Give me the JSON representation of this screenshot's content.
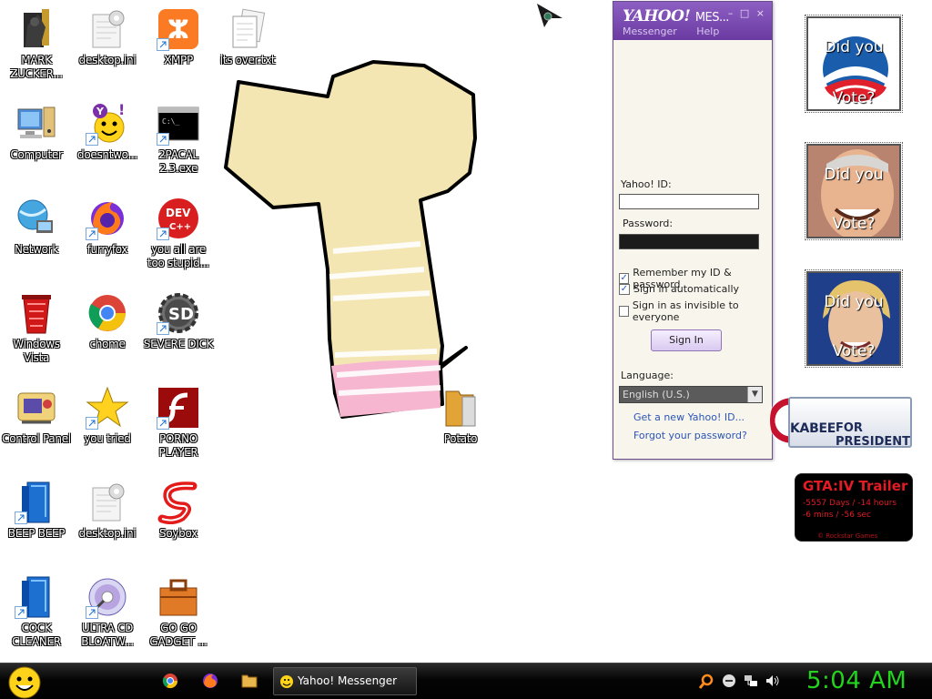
{
  "desktop": {
    "icons": [
      {
        "label": "MARK ZUCKER..."
      },
      {
        "label": "desktop.ini"
      },
      {
        "label": "XMPP"
      },
      {
        "label": "its over.txt"
      },
      {
        "label": "Computer"
      },
      {
        "label": "doesntwo..."
      },
      {
        "label": "2PACAL 2.3.exe"
      },
      {
        "label": "Network"
      },
      {
        "label": "furryfox"
      },
      {
        "label": "you all are too stupid..."
      },
      {
        "label": "Windows Vista"
      },
      {
        "label": "chome"
      },
      {
        "label": "SEVERE DICK"
      },
      {
        "label": "Control Panel"
      },
      {
        "label": "you tried"
      },
      {
        "label": "PORNO PLAYER"
      },
      {
        "label": "BEEP BEEP"
      },
      {
        "label": "desktop.ini"
      },
      {
        "label": "Soybox"
      },
      {
        "label": "COCK CLEANER"
      },
      {
        "label": "ULTRA CD BLOATW..."
      },
      {
        "label": "GO GO GADGET ..."
      },
      {
        "label": "Potato"
      }
    ]
  },
  "messenger": {
    "brand": "YAHOO!",
    "title_suffix": "MES...",
    "window_buttons": "– □ ×",
    "menu": [
      "Messenger",
      "Help"
    ],
    "yahoo_id_label": "Yahoo! ID:",
    "yahoo_id_value": "",
    "password_label": "Password:",
    "remember_label": "Remember my ID & password",
    "remember_checked": true,
    "auto_label": "Sign in automatically",
    "auto_checked": true,
    "invisible_label": "Sign in as invisible to everyone",
    "invisible_checked": false,
    "signin_label": "Sign In",
    "language_label": "Language:",
    "language_value": "English (U.S.)",
    "link_new_id": "Get a new Yahoo! ID...",
    "link_forgot": "Forgot your password?"
  },
  "gadgets": {
    "vote1": {
      "line1": "Did you",
      "line2": "Vote?"
    },
    "vote2": {
      "line1": "Did you",
      "line2": "Vote?"
    },
    "vote3": {
      "line1": "Did you",
      "line2": "Vote?"
    },
    "huckabee": {
      "name": "KABEE",
      "slogan": "FOR PRESIDENT"
    },
    "gta": {
      "title": "GTA:IV  Trailer",
      "line1": "-5557 Days / -14 hours",
      "line2": "-6 mins / -56 sec",
      "footer": "© Rockstar Games"
    }
  },
  "taskbar": {
    "active_task": "Yahoo! Messenger",
    "clock": "5:04 AM",
    "quick_launch": [
      "chrome-icon",
      "firefox-icon",
      "folder-icon"
    ],
    "tray": [
      "search-icon",
      "minus-icon",
      "network-icon",
      "volume-icon"
    ]
  },
  "colors": {
    "accent_purple": "#6a3aa2",
    "clock_green": "#23d31e",
    "gta_red": "#e21c24"
  }
}
